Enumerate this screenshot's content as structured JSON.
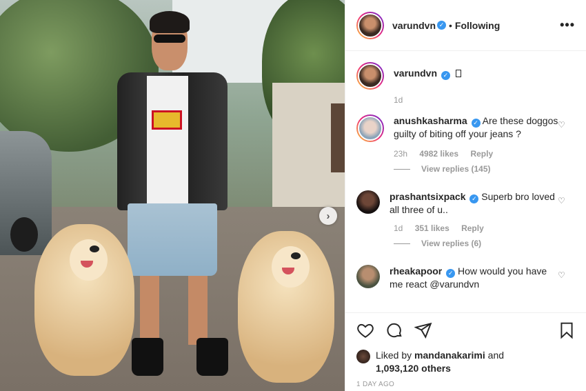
{
  "post": {
    "author": "varundvn",
    "follow_status": "Following",
    "more_icon": "more-options-icon",
    "caption_user": "varundvn",
    "caption_age": "1d"
  },
  "comments": [
    {
      "user": "anushkasharma",
      "text": "Are these doggos guilty of biting off your jeans ?",
      "age": "23h",
      "likes": "4982 likes",
      "reply_label": "Reply",
      "replies": "View replies (145)"
    },
    {
      "user": "prashantsixpack",
      "text": "Superb bro loved all three of u..",
      "age": "1d",
      "likes": "351 likes",
      "reply_label": "Reply",
      "replies": "View replies (6)"
    },
    {
      "user": "rheakapoor",
      "text": "How would you have me react @varundvn"
    }
  ],
  "likes": {
    "prefix": "Liked by",
    "user": "mandanakarimi",
    "suffix": "and",
    "others": "1,093,120 others"
  },
  "timestamp": "1 DAY AGO",
  "colors": {
    "verified": "#3897f0",
    "secondary_text": "#999999",
    "story_ring": [
      "#f9ce34",
      "#ee2a7b",
      "#6228d7"
    ]
  }
}
